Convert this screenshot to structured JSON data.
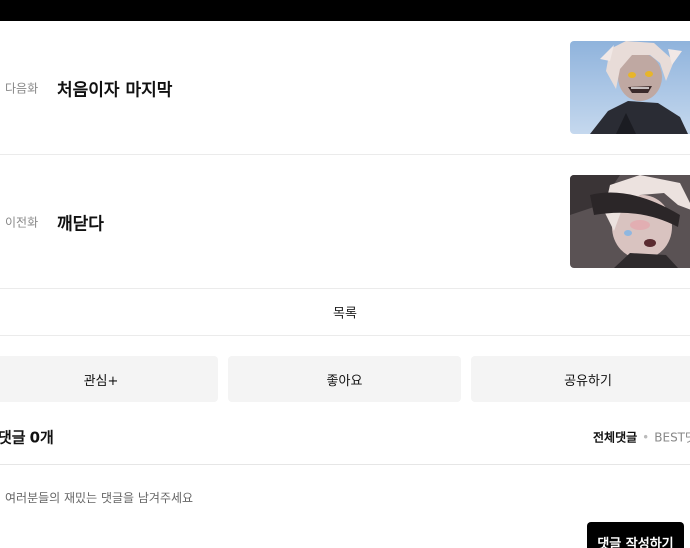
{
  "navigation": {
    "next": {
      "kind_label": "다음화",
      "title": "처음이자 마지막"
    },
    "prev": {
      "kind_label": "이전화",
      "title": "깨닫다"
    }
  },
  "list_label": "목록",
  "actions": {
    "interest_label": "관심+",
    "like_label": "좋아요",
    "share_label": "공유하기"
  },
  "comments": {
    "title": "댓글",
    "count": "0개",
    "sort_all": "전체댓글",
    "sort_best": "BEST댓글",
    "placeholder": "여러분들의 재밌는 댓글을 남겨주세요",
    "write_button": "댓글 작성하기"
  },
  "colors": {
    "top_bar": "#000000",
    "button_bg": "#f4f4f4",
    "divider": "#ebebeb",
    "write_button_bg": "#000000"
  }
}
